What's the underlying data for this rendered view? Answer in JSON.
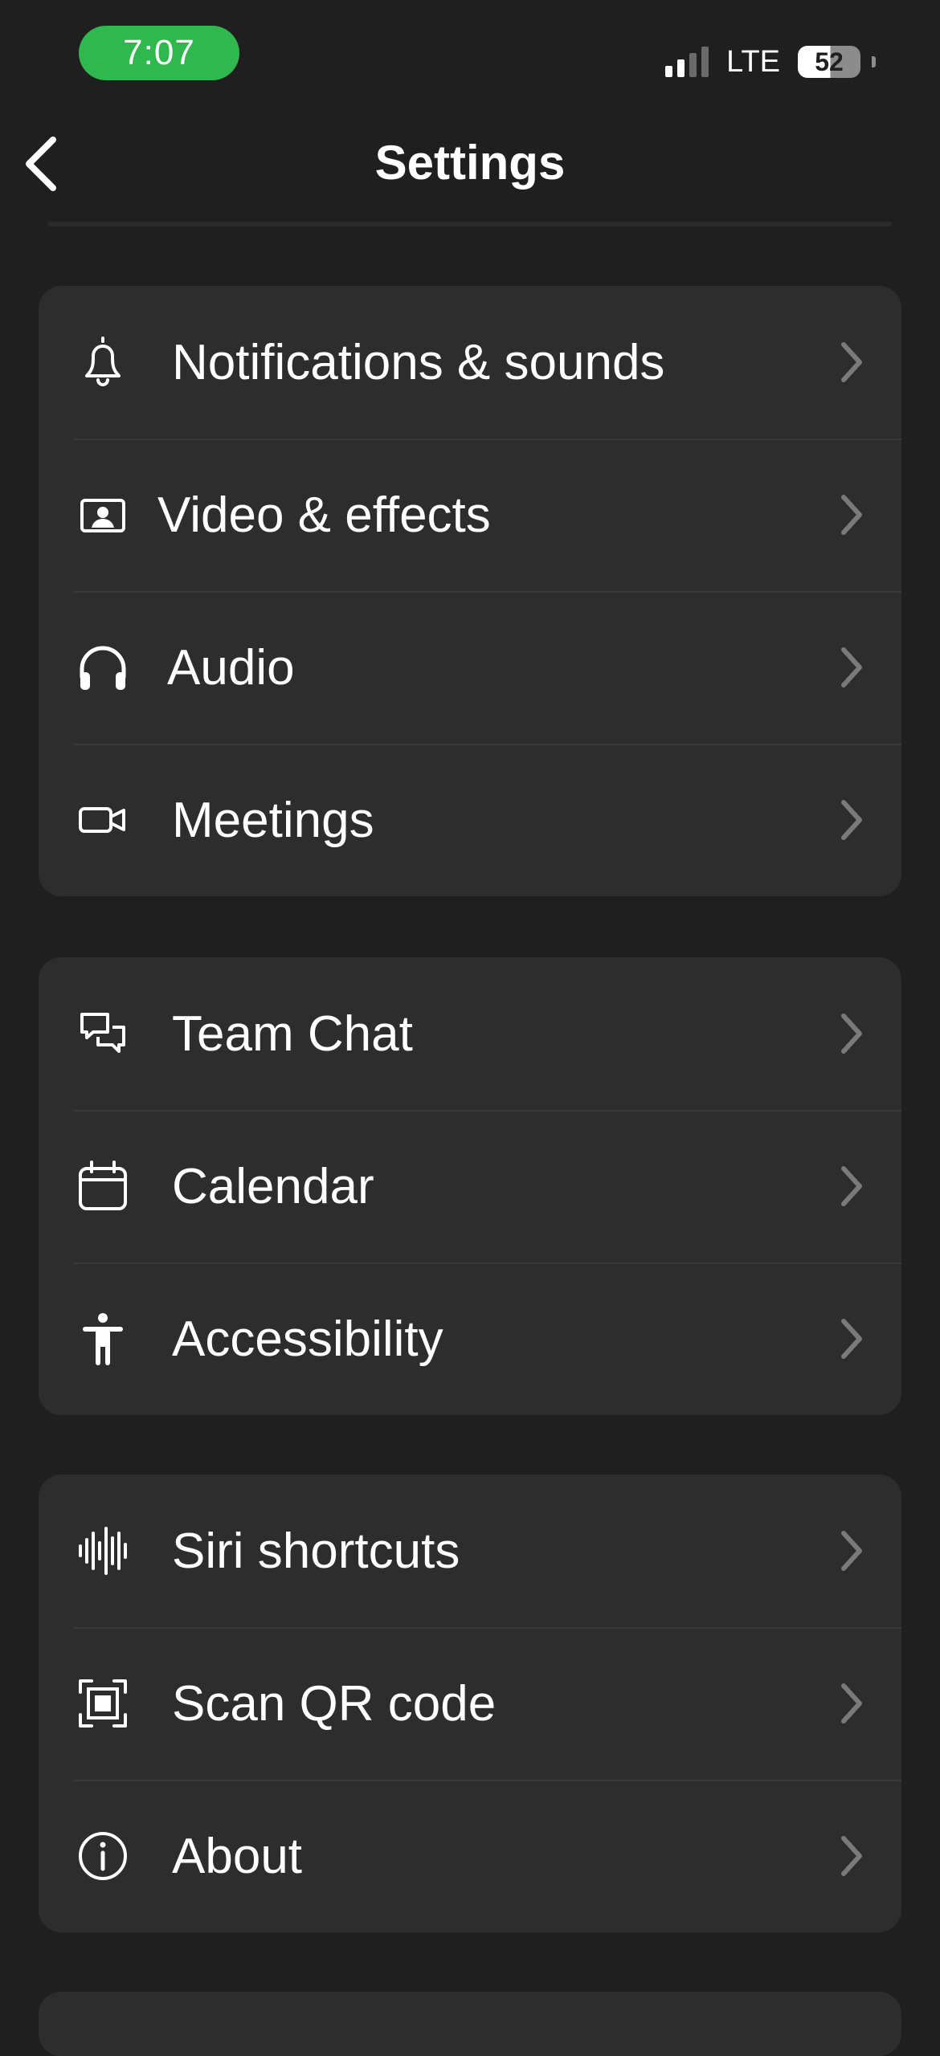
{
  "status_bar": {
    "time": "7:07",
    "network": "LTE",
    "battery": "52",
    "signal_bars_active": 2,
    "signal_bars_total": 4,
    "time_pill_color": "#30b84e"
  },
  "header": {
    "title": "Settings",
    "back_icon": "chevron-left-icon"
  },
  "groups": [
    {
      "items": [
        {
          "label": "Notifications & sounds",
          "icon": "bell-icon"
        },
        {
          "label": "Video & effects",
          "icon": "video-portrait-icon"
        },
        {
          "label": "Audio",
          "icon": "headphones-icon"
        },
        {
          "label": "Meetings",
          "icon": "video-camera-icon"
        }
      ]
    },
    {
      "items": [
        {
          "label": "Team Chat",
          "icon": "chat-bubbles-icon"
        },
        {
          "label": "Calendar",
          "icon": "calendar-icon"
        },
        {
          "label": "Accessibility",
          "icon": "accessibility-icon"
        }
      ]
    },
    {
      "items": [
        {
          "label": "Siri shortcuts",
          "icon": "waveform-icon"
        },
        {
          "label": "Scan QR code",
          "icon": "qr-scan-icon"
        },
        {
          "label": "About",
          "icon": "info-icon"
        }
      ]
    }
  ],
  "colors": {
    "background": "#1f1f1f",
    "card": "#2d2d2d",
    "divider": "#3a3a3a",
    "chevron": "#7a7a7a",
    "text": "#ffffff"
  }
}
